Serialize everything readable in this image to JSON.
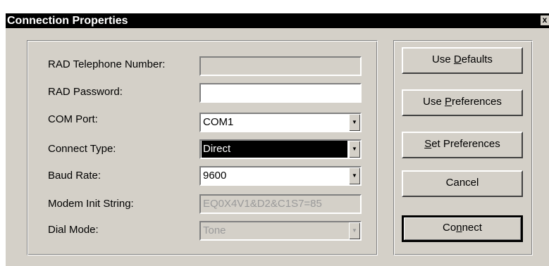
{
  "window": {
    "title": "Connection Properties",
    "close_glyph": "x"
  },
  "form": {
    "rad_phone": {
      "label": "RAD Telephone Number:",
      "value": ""
    },
    "rad_password": {
      "label": "RAD Password:",
      "value": ""
    },
    "com_port": {
      "label": "COM Port:",
      "value": "COM1"
    },
    "connect_type": {
      "label": "Connect Type:",
      "value": "Direct"
    },
    "baud_rate": {
      "label": "Baud Rate:",
      "value": "9600"
    },
    "modem_init": {
      "label": "Modem Init String:",
      "value": "EQ0X4V1&D2&C1S7=85"
    },
    "dial_mode": {
      "label": "Dial Mode:",
      "value": "Tone"
    }
  },
  "buttons": {
    "use_defaults": {
      "pre": "Use ",
      "u": "D",
      "post": "efaults"
    },
    "use_preferences": {
      "pre": "Use ",
      "u": "P",
      "post": "references"
    },
    "set_preferences": {
      "pre": "",
      "u": "S",
      "post": "et Preferences"
    },
    "cancel": {
      "pre": "Cancel",
      "u": "",
      "post": ""
    },
    "connect": {
      "pre": "Co",
      "u": "n",
      "post": "nect"
    }
  },
  "icons": {
    "dropdown": "dropdown-arrow-icon",
    "close": "close-icon"
  }
}
